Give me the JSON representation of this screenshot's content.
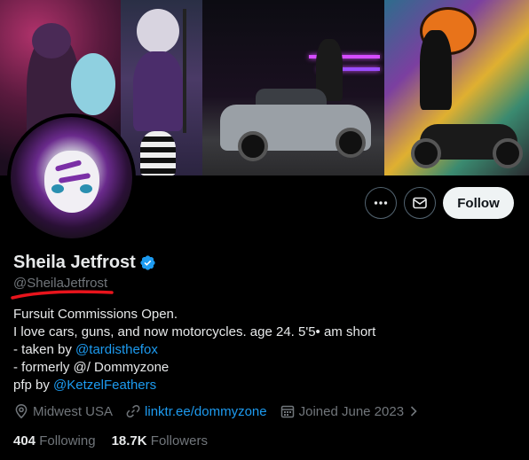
{
  "profile": {
    "name": "Sheila Jetfrost",
    "handle": "@SheilaJetfrost",
    "verified": true,
    "accent_color": "#1d9bf0"
  },
  "actions": {
    "more_icon": "ellipsis-icon",
    "message_icon": "envelope-icon",
    "follow_label": "Follow"
  },
  "bio": {
    "line1": "Fursuit Commissions Open.",
    "line2": "I love cars, guns, and now motorcycles. age 24. 5'5• am short",
    "line3_prefix": "- taken by ",
    "line3_link": "@tardisthefox",
    "line4": "- formerly @/ Dommyzone",
    "line5_prefix": "pfp by ",
    "line5_link": "@KetzelFeathers"
  },
  "meta": {
    "location": "Midwest USA",
    "website": "linktr.ee/dommyzone",
    "joined": "Joined June 2023"
  },
  "stats": {
    "following_count": "404",
    "following_label": "Following",
    "followers_count": "18.7K",
    "followers_label": "Followers"
  }
}
